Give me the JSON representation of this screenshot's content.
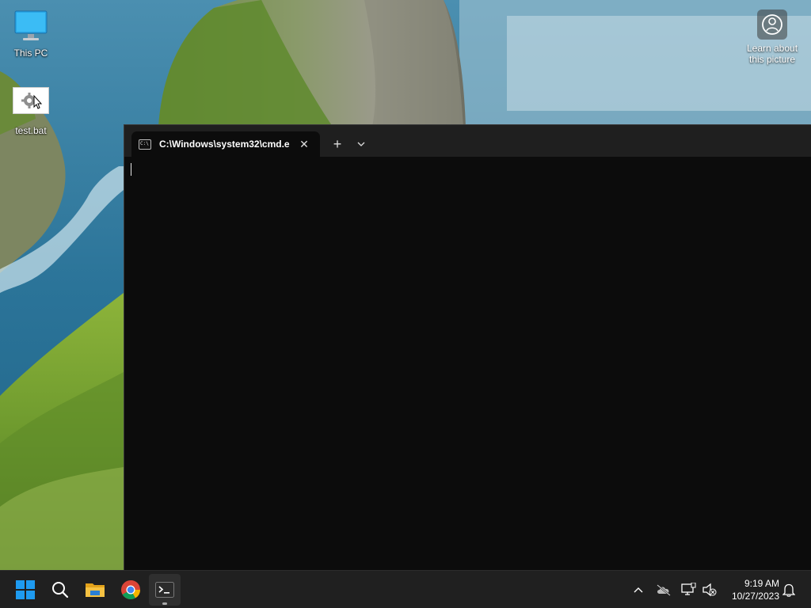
{
  "desktop": {
    "icons": [
      {
        "label": "This PC",
        "icon": "computer-monitor-icon"
      },
      {
        "label": "test.bat",
        "icon": "batch-file-gear-icon"
      }
    ],
    "learn_about": {
      "label": "Learn about this picture",
      "icon": "camera-lens-icon"
    }
  },
  "terminal": {
    "tab_title": "C:\\Windows\\system32\\cmd.e:",
    "tab_icon": "cmd-icon",
    "tab_icon_text": "C:\\",
    "close_label": "✕",
    "new_tab_label": "+",
    "dropdown_icon": "chevron-down-icon",
    "background": "#0c0c0c"
  },
  "taskbar": {
    "pinned": [
      {
        "name": "Start",
        "icon": "windows-start-icon"
      },
      {
        "name": "Search",
        "icon": "search-icon"
      },
      {
        "name": "File Explorer",
        "icon": "folder-icon"
      },
      {
        "name": "Google Chrome",
        "icon": "chrome-icon"
      },
      {
        "name": "Terminal",
        "icon": "terminal-icon",
        "active": true
      }
    ],
    "tray": [
      {
        "name": "Show hidden icons",
        "icon": "chevron-up-icon"
      },
      {
        "name": "OneDrive",
        "icon": "cloud-off-icon"
      },
      {
        "name": "Network",
        "icon": "network-icon"
      },
      {
        "name": "Volume",
        "icon": "speaker-muted-icon"
      }
    ],
    "time": "9:19 AM",
    "date": "10/27/2023",
    "notification_icon": "bell-icon"
  },
  "colors": {
    "taskbar": "#202020",
    "tab_bar": "#1f1f1f",
    "windows_blue": "#1e9bf0"
  }
}
